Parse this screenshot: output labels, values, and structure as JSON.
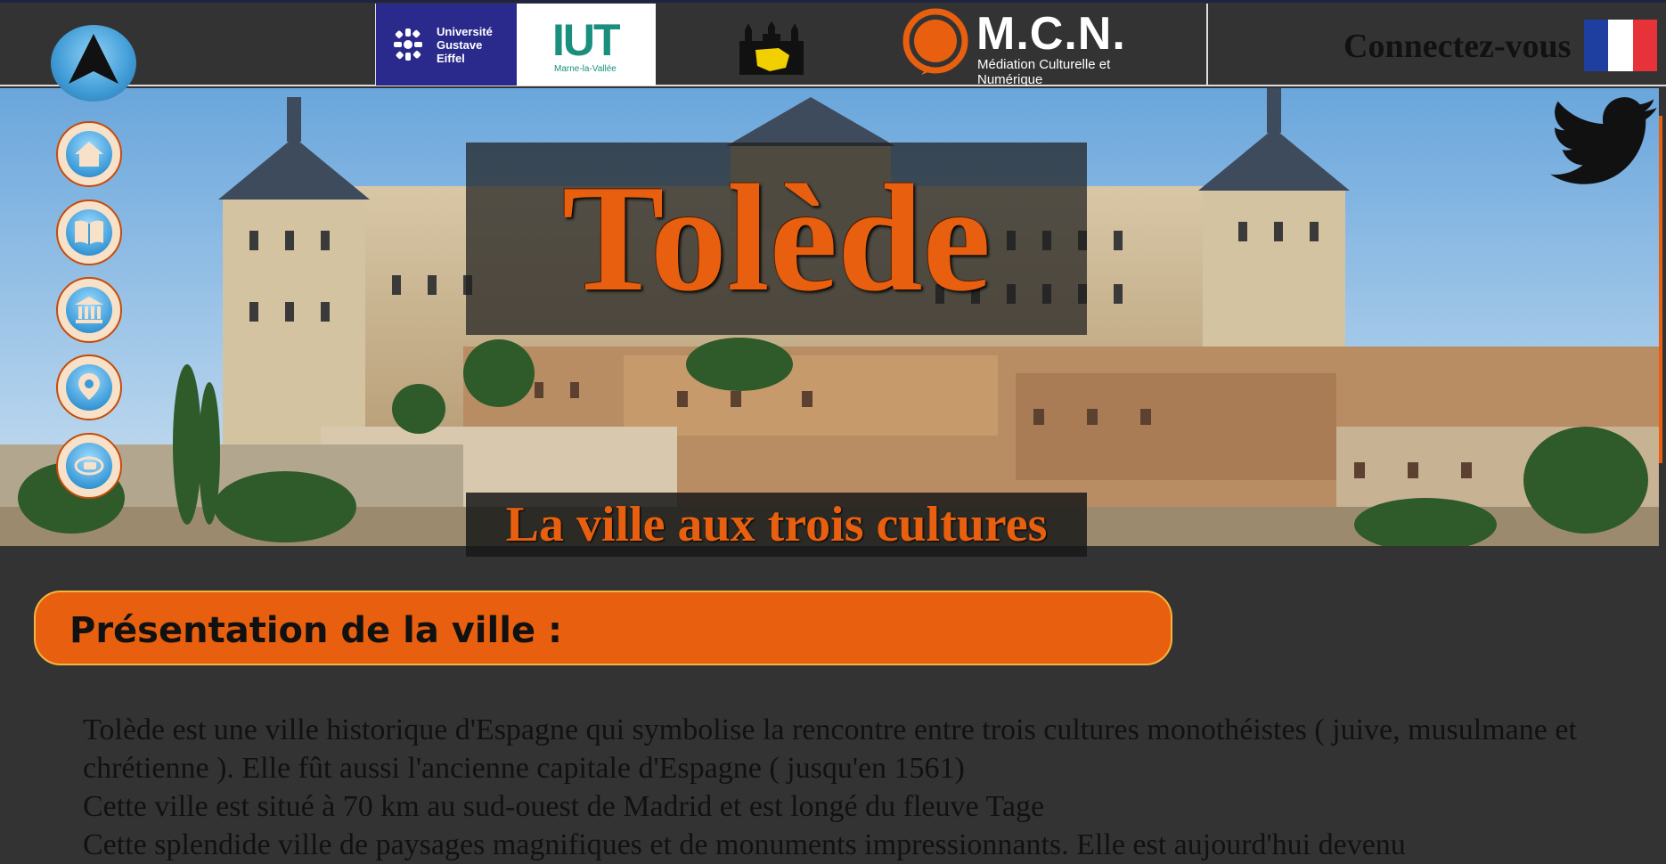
{
  "header": {
    "logos": {
      "uge": [
        "Université",
        "Gustave",
        "Eiffel"
      ],
      "iut": {
        "name": "IUT",
        "sub": "Marne-la-Vallée"
      },
      "mcn": {
        "name": "M.C.N.",
        "sub": "Médiation Culturelle et Numérique"
      }
    },
    "connect_label": "Connectez-vous",
    "flag_colors": [
      "#1f3fa0",
      "#ffffff",
      "#e8323a"
    ]
  },
  "hero": {
    "title": "Tolède",
    "subtitle": "La ville aux trois cultures"
  },
  "side_nav": {
    "icons": [
      "home-icon",
      "book-icon",
      "museum-icon",
      "location-pin-icon",
      "chat-icon"
    ]
  },
  "presentation": {
    "heading": "Présentation de la ville :",
    "paragraphs": [
      "Tolède est une ville historique d'Espagne qui symbolise la rencontre entre trois cultures monothéistes ( juive, musulmane et chrétienne ). Elle fût aussi l'ancienne capitale d'Espagne ( jusqu'en 1561)",
      "Cette ville est situé à 70 km au sud-ouest de Madrid et est longé du fleuve Tage",
      "Cette splendide ville de paysages magnifiques et de monuments impressionnants. Elle est aujourd'hui devenu"
    ]
  },
  "colors": {
    "accent": "#e8600f",
    "background": "#333333",
    "border": "#f5b53d"
  }
}
